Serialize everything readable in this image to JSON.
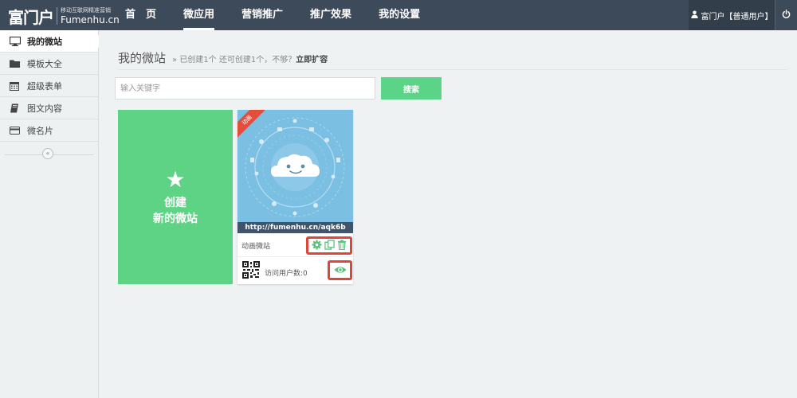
{
  "logo": {
    "mark": "富门户",
    "tagline": "移动互联网精准营销",
    "domain": "Fumenhu.cn"
  },
  "nav": [
    {
      "label": "首　页",
      "active": false
    },
    {
      "label": "微应用",
      "active": true
    },
    {
      "label": "营销推广",
      "active": false
    },
    {
      "label": "推广效果",
      "active": false
    },
    {
      "label": "我的设置",
      "active": false
    }
  ],
  "user": {
    "label": "富门户【普通用户】",
    "icon": "user-icon"
  },
  "power": {
    "icon": "power-icon"
  },
  "sidebar": {
    "items": [
      {
        "label": "我的微站",
        "icon": "monitor-icon",
        "active": true
      },
      {
        "label": "模板大全",
        "icon": "folder-icon",
        "active": false
      },
      {
        "label": "超级表单",
        "icon": "calendar-icon",
        "active": false
      },
      {
        "label": "图文内容",
        "icon": "book-icon",
        "active": false
      },
      {
        "label": "微名片",
        "icon": "card-icon",
        "active": false
      }
    ],
    "collapse_label": "«"
  },
  "main": {
    "title": "我的微站",
    "subtitle_prefix": "» 已创建1个 还可创建1个，不够？",
    "subtitle_link": "立即扩容",
    "search": {
      "placeholder": "输入关键字",
      "value": "",
      "button": "搜索"
    },
    "create_card": {
      "star": "★",
      "line1": "创建",
      "line2": "新的微站"
    },
    "site_card": {
      "badge": "动画",
      "url": "http://fumenhu.cn/aqk6b",
      "name": "动画微站",
      "visits": "访问用户数:0"
    }
  },
  "colors": {
    "topbar": "#3d4a59",
    "accent_green": "#5ed385",
    "highlight_red": "#e0453a",
    "ribbon_red": "#e44d3a"
  }
}
